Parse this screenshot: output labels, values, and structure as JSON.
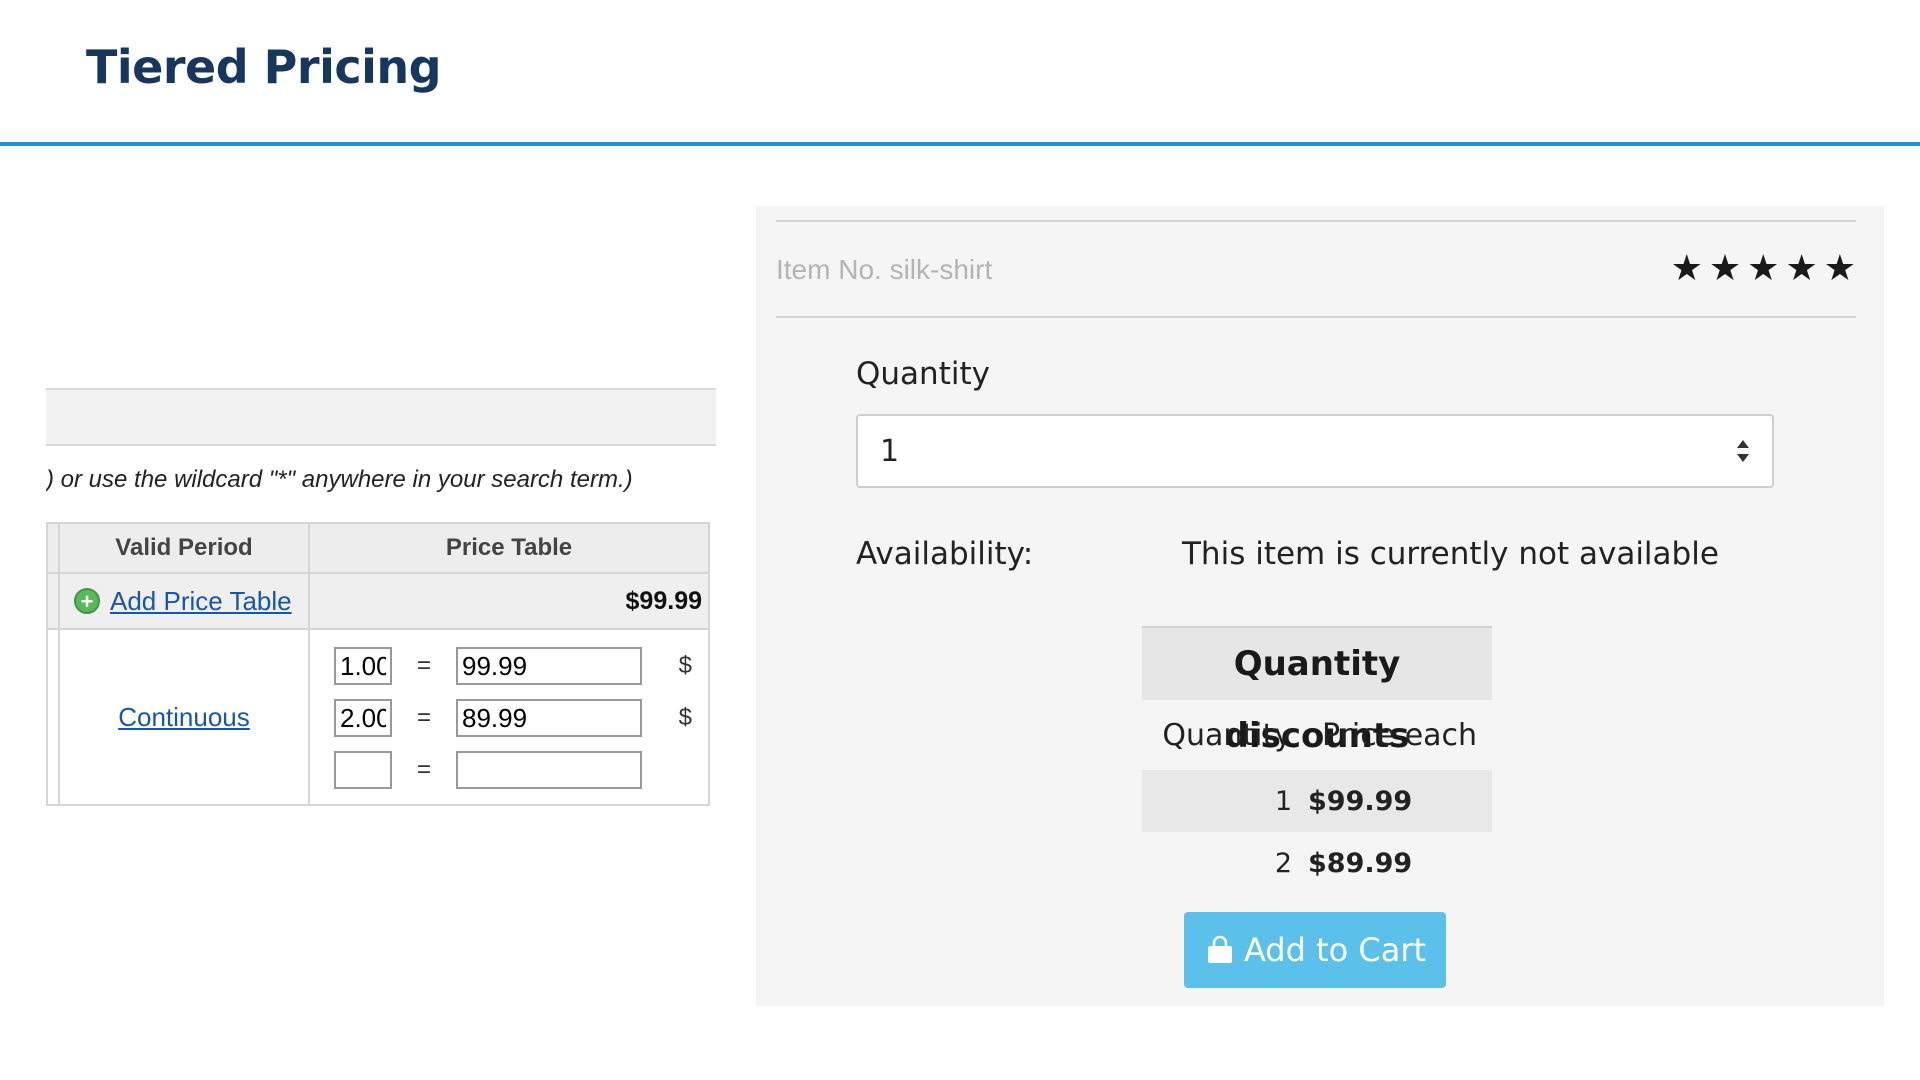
{
  "slide": {
    "title": "Tiered Pricing"
  },
  "admin": {
    "hint": ") or use the wildcard \"*\" anywhere in your search term.)",
    "headers": {
      "valid_period": "Valid Period",
      "price_table": "Price Table"
    },
    "add_price_table": "Add Price Table",
    "base_price": "$99.99",
    "valid_period_link": "Continuous",
    "rows": [
      {
        "qty": "1.00",
        "eq": "=",
        "price": "99.99",
        "currency": "$"
      },
      {
        "qty": "2.00",
        "eq": "=",
        "price": "89.99",
        "currency": "$"
      },
      {
        "qty": "",
        "eq": "=",
        "price": "",
        "currency": ""
      }
    ]
  },
  "store": {
    "item_no": "Item No. silk-shirt",
    "rating_stars": 5,
    "quantity_label": "Quantity",
    "quantity_value": "1",
    "availability_label": "Availability:",
    "availability_value": "This item is currently not available",
    "discounts": {
      "title": "Quantity discounts",
      "col_quantity": "Quantity",
      "col_price": "Price each",
      "rows": [
        {
          "qty": "1",
          "price": "$99.99"
        },
        {
          "qty": "2",
          "price": "$89.99"
        }
      ]
    },
    "add_to_cart": "Add to Cart",
    "colors": {
      "button": "#5bc0ea",
      "title": "#17375e",
      "rule": "#1f94d2"
    }
  }
}
